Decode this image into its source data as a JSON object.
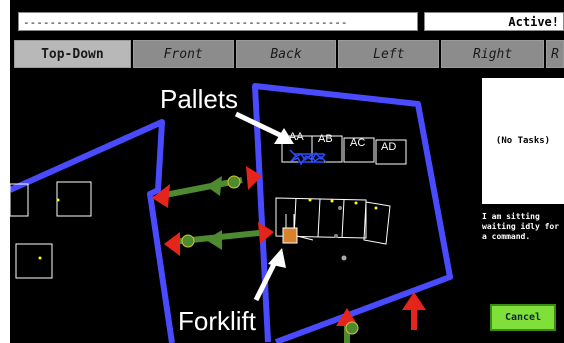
{
  "command_line": "-------------------------------------------------",
  "status": "Active!",
  "views": [
    {
      "label": "Top-Down",
      "active": true
    },
    {
      "label": "Front",
      "active": false
    },
    {
      "label": "Back",
      "active": false
    },
    {
      "label": "Left",
      "active": false
    },
    {
      "label": "Right",
      "active": false
    },
    {
      "label": "R",
      "active": false
    }
  ],
  "map": {
    "annotations": {
      "pallets": "Pallets",
      "forklift": "Forklift"
    },
    "pallet_labels": [
      "AA",
      "AB",
      "AC",
      "AD"
    ],
    "colors": {
      "boundary": "#4a4aff",
      "arrow_red": "#e5251b",
      "arrow_green": "#4e8a2f",
      "forklift": "#d9822b",
      "pallet": "#2a4dff"
    }
  },
  "tasks": {
    "empty_label": "(No Tasks)"
  },
  "robot_message": "I am sitting waiting idly for a command.",
  "cancel_label": "Cancel"
}
